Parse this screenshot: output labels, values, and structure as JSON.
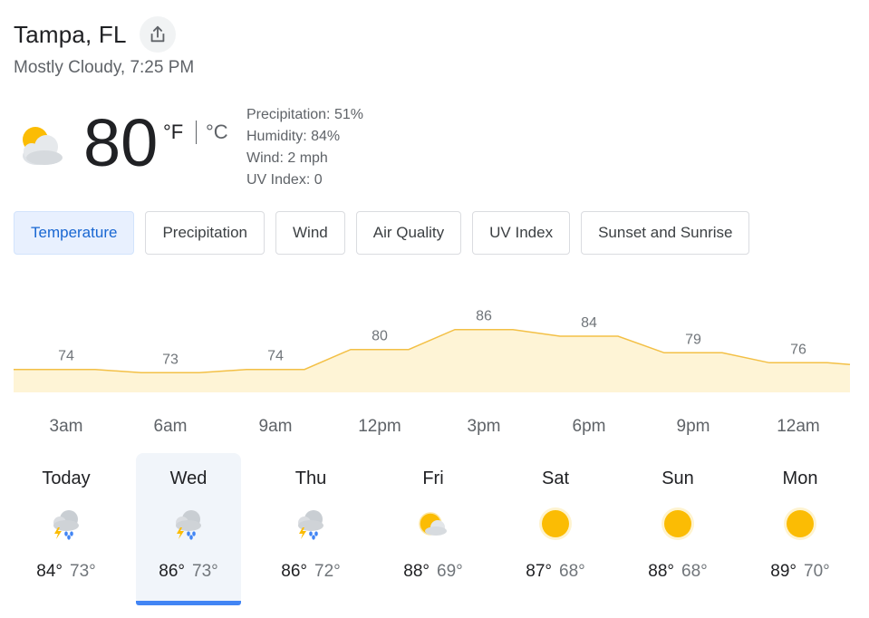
{
  "location": "Tampa, FL",
  "subtitle": "Mostly Cloudy, 7:25 PM",
  "current": {
    "temperature": "80",
    "unit_f": "°F",
    "unit_c": "°C",
    "icon": "partly-cloudy-icon",
    "details": {
      "precipitation": "Precipitation: 51%",
      "humidity": "Humidity: 84%",
      "wind": "Wind: 2 mph",
      "uv": "UV Index: 0"
    }
  },
  "tabs": [
    "Temperature",
    "Precipitation",
    "Wind",
    "Air Quality",
    "UV Index",
    "Sunset and Sunrise"
  ],
  "active_tab": 0,
  "colors": {
    "accent": "#4285f4",
    "active_tab_bg": "#e8f0fe",
    "active_tab_text": "#1967d2",
    "chart_fill": "#fef4d6",
    "chart_line": "#f3c046",
    "sun": "#fbbc04"
  },
  "chart_data": {
    "type": "area",
    "x": [
      "3am",
      "6am",
      "9am",
      "12pm",
      "3pm",
      "6pm",
      "9pm",
      "12am"
    ],
    "values": [
      74,
      73,
      74,
      80,
      86,
      84,
      79,
      76
    ],
    "labels": [
      "74",
      "73",
      "74",
      "80",
      "86",
      "84",
      "79",
      "76"
    ]
  },
  "days": [
    {
      "name": "Today",
      "high": "84°",
      "low": "73°",
      "icon": "thunderstorm-icon"
    },
    {
      "name": "Wed",
      "high": "86°",
      "low": "73°",
      "icon": "thunderstorm-icon"
    },
    {
      "name": "Thu",
      "high": "86°",
      "low": "72°",
      "icon": "thunderstorm-icon"
    },
    {
      "name": "Fri",
      "high": "88°",
      "low": "69°",
      "icon": "partly-cloudy-icon"
    },
    {
      "name": "Sat",
      "high": "87°",
      "low": "68°",
      "icon": "sunny-icon"
    },
    {
      "name": "Sun",
      "high": "88°",
      "low": "68°",
      "icon": "sunny-icon"
    },
    {
      "name": "Mon",
      "high": "89°",
      "low": "70°",
      "icon": "sunny-icon"
    }
  ],
  "selected_day": 1
}
